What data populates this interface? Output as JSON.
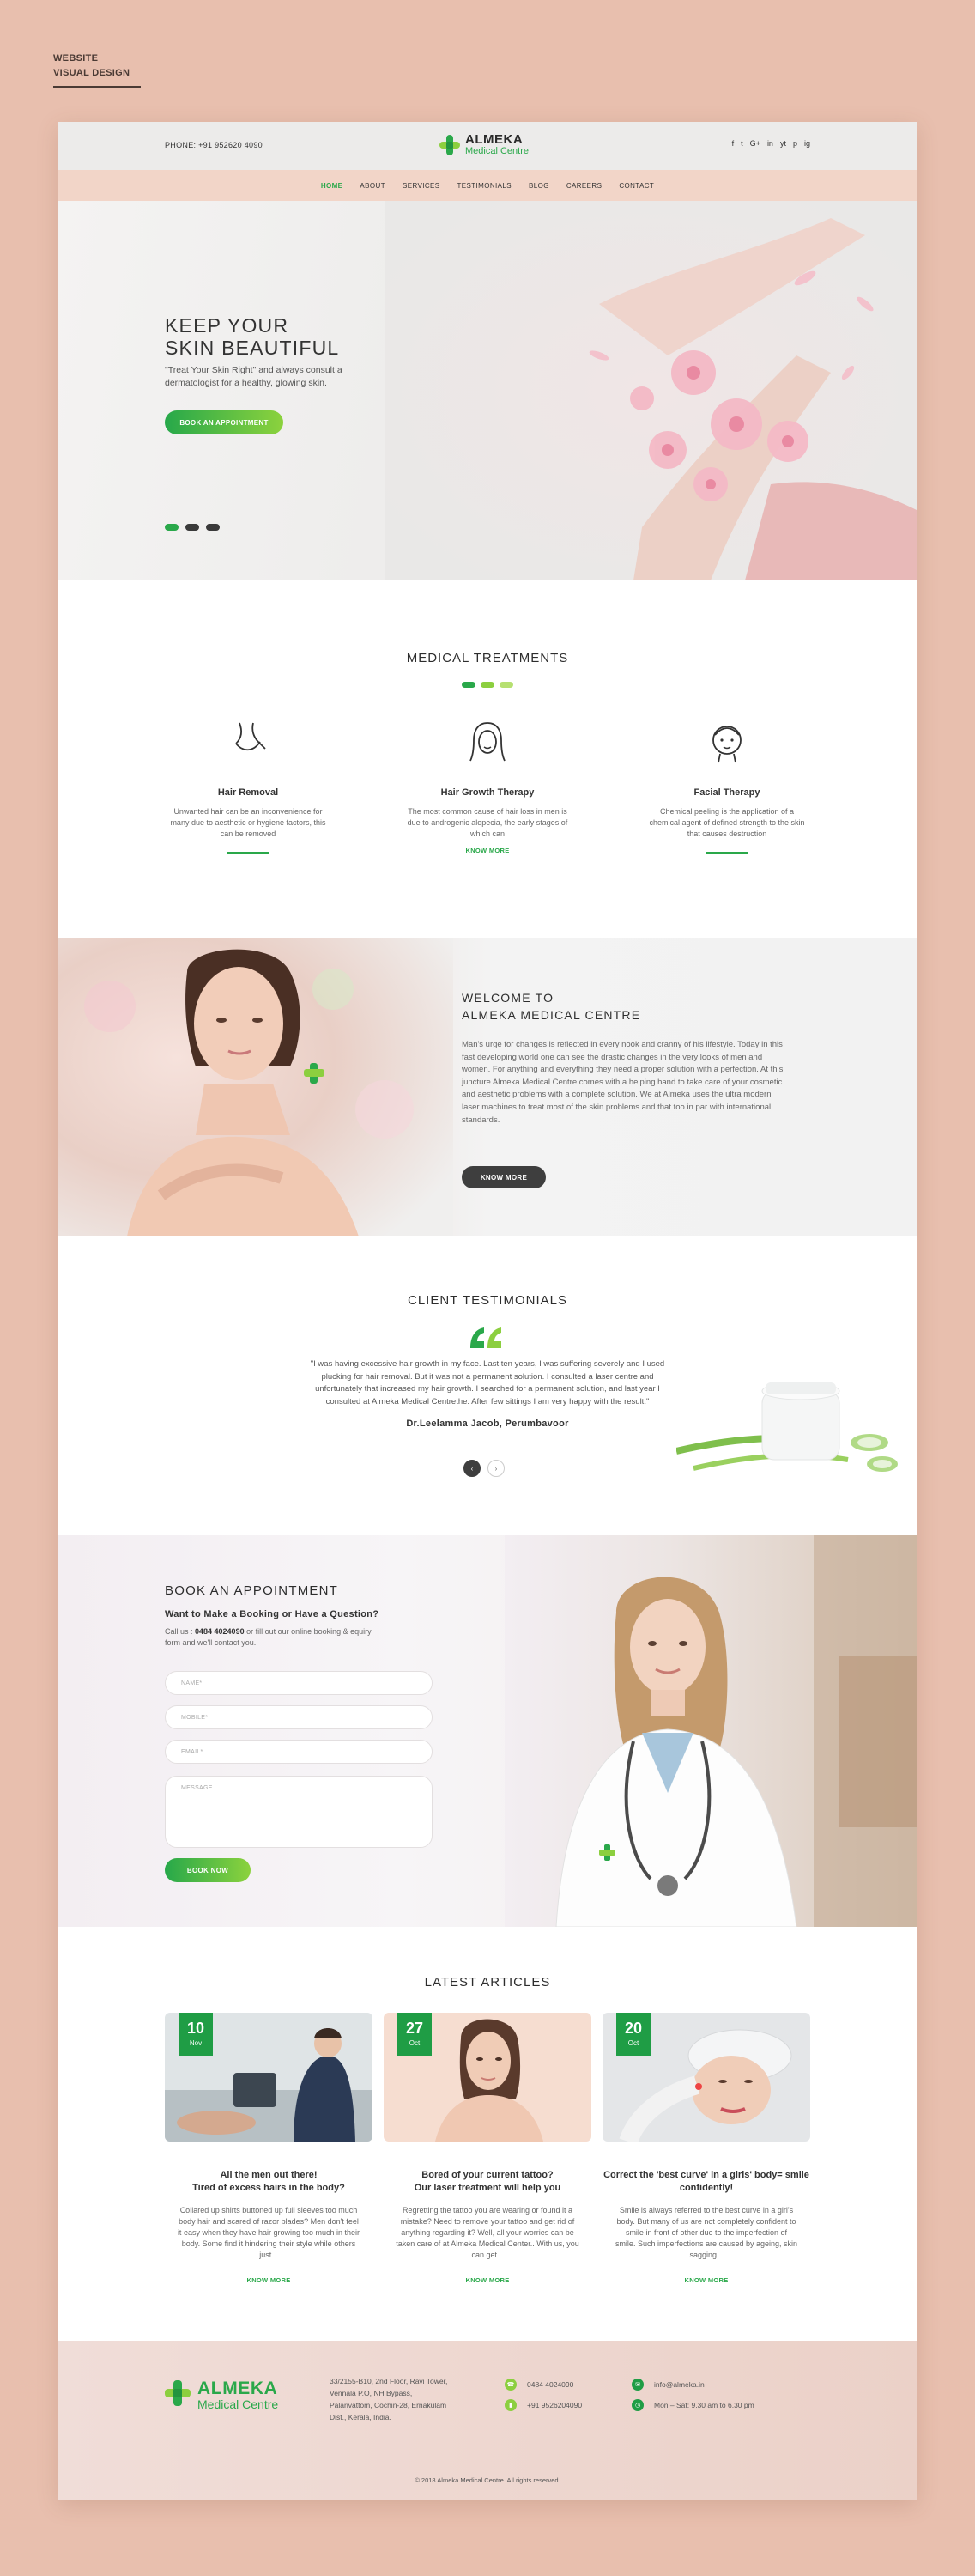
{
  "presentation": {
    "label_line1": "WEBSITE",
    "label_line2": "VISUAL DESIGN"
  },
  "header": {
    "phone": "PHONE: +91 952620 4090",
    "logo_name": "ALMEKA",
    "logo_sub": "Medical Centre",
    "social": [
      "f",
      "t",
      "G+",
      "in",
      "yt",
      "p",
      "ig"
    ]
  },
  "nav": {
    "items": [
      "HOME",
      "ABOUT",
      "SERVICES",
      "TESTIMONIALS",
      "BLOG",
      "CAREERS",
      "CONTACT"
    ],
    "active": "HOME"
  },
  "hero": {
    "title_line1": "KEEP YOUR",
    "title_line2": "SKIN BEAUTIFUL",
    "text": "\"Treat Your Skin Right\" and always consult a dermatologist for a healthy, glowing skin.",
    "button": "BOOK AN APPOINTMENT"
  },
  "treatments": {
    "title": "MEDICAL TREATMENTS",
    "items": [
      {
        "icon": "neck-icon",
        "title": "Hair Removal",
        "text": "Unwanted hair can be an inconvenience for many due to aesthetic or hygiene factors, this can be removed",
        "more": ""
      },
      {
        "icon": "woman-face-icon",
        "title": "Hair Growth Therapy",
        "text": "The most common cause of hair loss in men is due to androgenic alopecia, the early stages of which can",
        "more": "KNOW MORE"
      },
      {
        "icon": "facial-icon",
        "title": "Facial Therapy",
        "text": "Chemical peeling is the application of a chemical agent of defined strength to the skin that causes destruction",
        "more": ""
      }
    ]
  },
  "welcome": {
    "title_line1": "WELCOME TO",
    "title_line2": "ALMEKA MEDICAL CENTRE",
    "text": "Man's urge for changes is reflected in every nook and cranny of his lifestyle. Today in this fast developing world one can see the drastic changes in the very looks of men and women. For anything and everything they need a proper solution with a perfection. At this juncture Almeka Medical Centre comes with a helping hand to take care of your cosmetic and aesthetic problems with a complete solution. We at Almeka uses the ultra modern laser machines to treat most of the skin problems and that too in par with international standards.",
    "button": "KNOW MORE"
  },
  "testimonials": {
    "title": "CLIENT TESTIMONIALS",
    "quote": "\"I was having excessive hair growth in my face. Last ten years, I was suffering severely and I used plucking for hair removal. But it was not a permanent solution. I consulted a laser centre and unfortunately that increased my hair growth. I searched for a permanent solution, and last year I consulted at Almeka Medical Centrethe. After few sittings I am very happy with the result.\"",
    "author": "Dr.Leelamma Jacob, Perumbavoor",
    "prev": "‹",
    "next": "›"
  },
  "booking": {
    "title": "BOOK AN APPOINTMENT",
    "subtitle": "Want to Make a Booking or Have a Question?",
    "call_prefix": "Call us : ",
    "call_number": "0484 4024090",
    "call_suffix": " or fill out our online booking & equiry form and we'll contact you.",
    "fields": {
      "name": "NAME*",
      "mobile": "MOBILE*",
      "email": "EMAIL*",
      "message": "MESSAGE"
    },
    "button": "BOOK NOW"
  },
  "articles": {
    "title": "LATEST ARTICLES",
    "items": [
      {
        "day": "10",
        "month": "Nov",
        "title": "All the men out there!\nTired of excess hairs in the body?",
        "text": "Collared up shirts buttoned up full sleeves too much body hair and scared of razor blades? Men don't feel it easy when they have hair growing too much in their body. Some find it hindering their style while others just...",
        "more": "KNOW MORE"
      },
      {
        "day": "27",
        "month": "Oct",
        "title": "Bored of your current tattoo?\nOur laser treatment will help you",
        "text": "Regretting the tattoo you are wearing or found it a mistake? Need to remove your tattoo and get rid of anything regarding it? Well, all your worries can be taken care of at Almeka Medical Center.. With us, you can get...",
        "more": "KNOW MORE"
      },
      {
        "day": "20",
        "month": "Oct",
        "title": "Correct the 'best curve' in a girls' body= smile confidently!",
        "text": "Smile is always referred to the best curve in a girl's body. But many of us are not completely confident to smile in front of other due to the imperfection of smile. Such imperfections are caused by ageing, skin sagging...",
        "more": "KNOW MORE"
      }
    ]
  },
  "footer": {
    "logo_name": "ALMEKA",
    "logo_sub": "Medical Centre",
    "address": "33/2155-B10, 2nd Floor, Ravi Tower, Vennala P.O, NH Bypass, Palarivattom, Cochin-28, Ernakulam Dist., Kerala, India.",
    "phone1": "0484 4024090",
    "phone2": "+91 9526204090",
    "email": "info@almeka.in",
    "hours": "Mon – Sat: 9.30 am to 6.30 pm",
    "copyright": "© 2018 Almeka Medical Centre. All rights reserved."
  },
  "colors": {
    "accent_green": "#2aa84a",
    "light_green": "#8ccf3f",
    "page_bg": "#e8bfae",
    "dark": "#3e3e3e"
  }
}
